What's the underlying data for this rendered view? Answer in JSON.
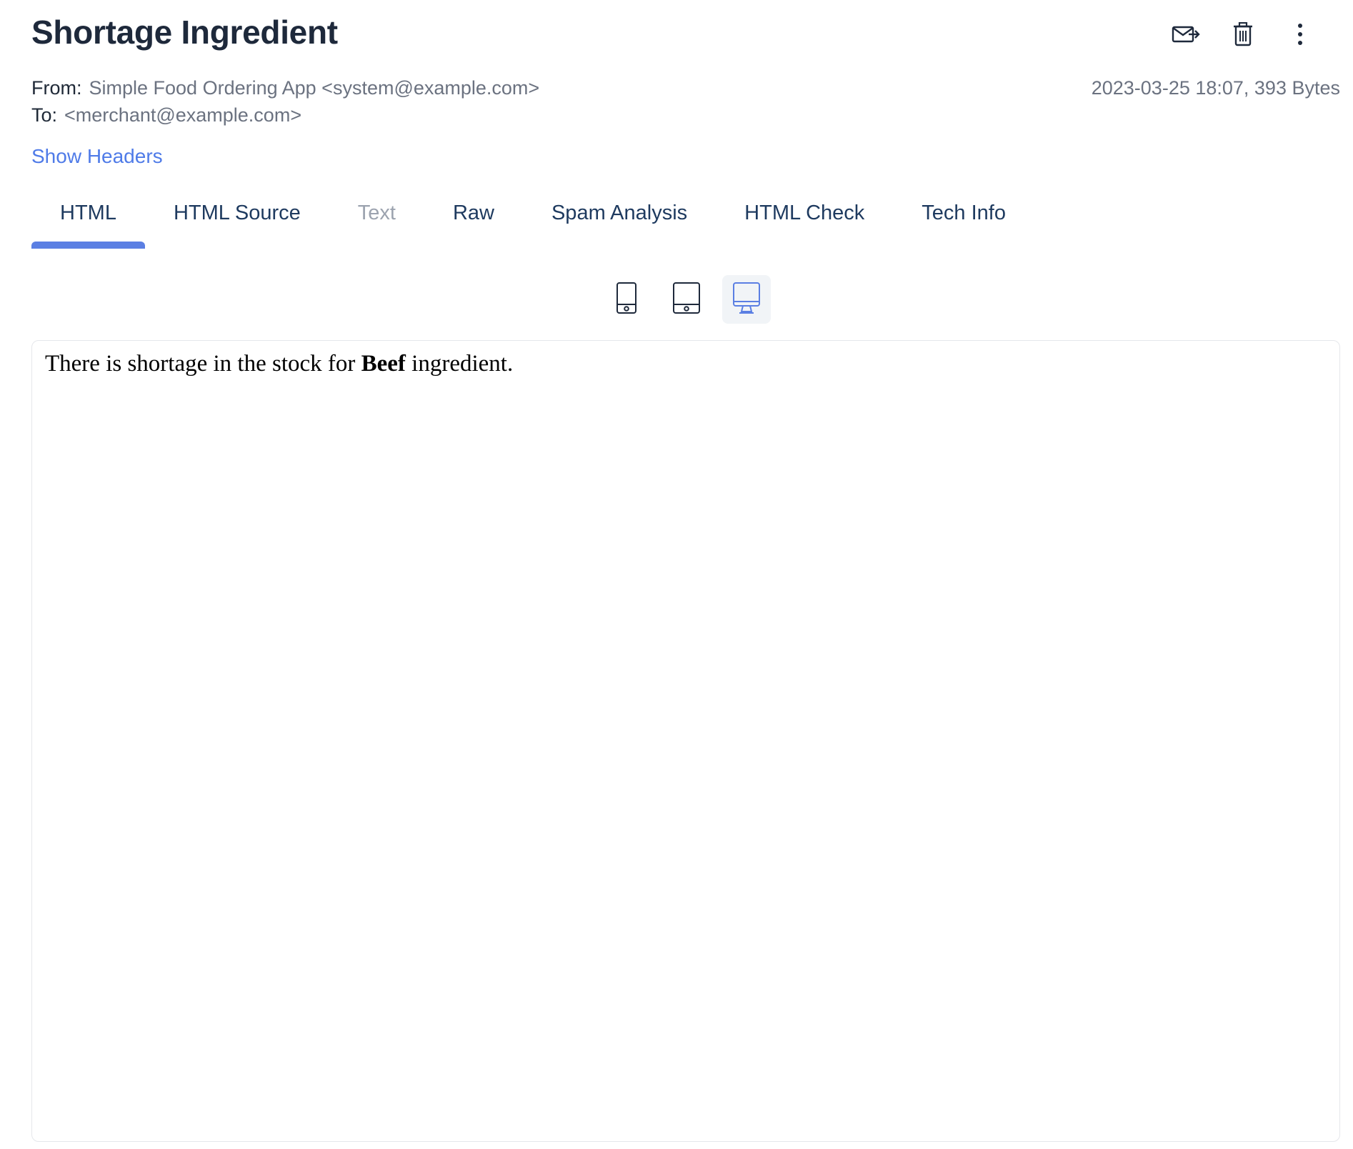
{
  "email": {
    "subject": "Shortage Ingredient",
    "from_label": "From:",
    "from_value": "Simple Food Ordering App <system@example.com>",
    "to_label": "To:",
    "to_value": "<merchant@example.com>",
    "date_size": "2023-03-25 18:07, 393 Bytes",
    "show_headers": "Show Headers"
  },
  "actions": {
    "icons": [
      "forward-mail-icon",
      "trash-icon",
      "more-vertical-icon"
    ]
  },
  "tabs": [
    {
      "label": "HTML",
      "state": "active"
    },
    {
      "label": "HTML Source",
      "state": "normal"
    },
    {
      "label": "Text",
      "state": "disabled"
    },
    {
      "label": "Raw",
      "state": "normal"
    },
    {
      "label": "Spam Analysis",
      "state": "normal"
    },
    {
      "label": "HTML Check",
      "state": "normal"
    },
    {
      "label": "Tech Info",
      "state": "normal"
    }
  ],
  "viewports": {
    "options": [
      "mobile-icon",
      "tablet-icon",
      "desktop-icon"
    ],
    "selected": "desktop-icon"
  },
  "preview": {
    "text_before": "There is shortage in the stock for",
    "bold": "Beef",
    "text_after": "ingredient."
  },
  "colors": {
    "accent": "#5b7fe3",
    "link": "#4f7be8",
    "title": "#1e293b",
    "muted": "#6b7280",
    "disabled": "#9ca3af"
  }
}
